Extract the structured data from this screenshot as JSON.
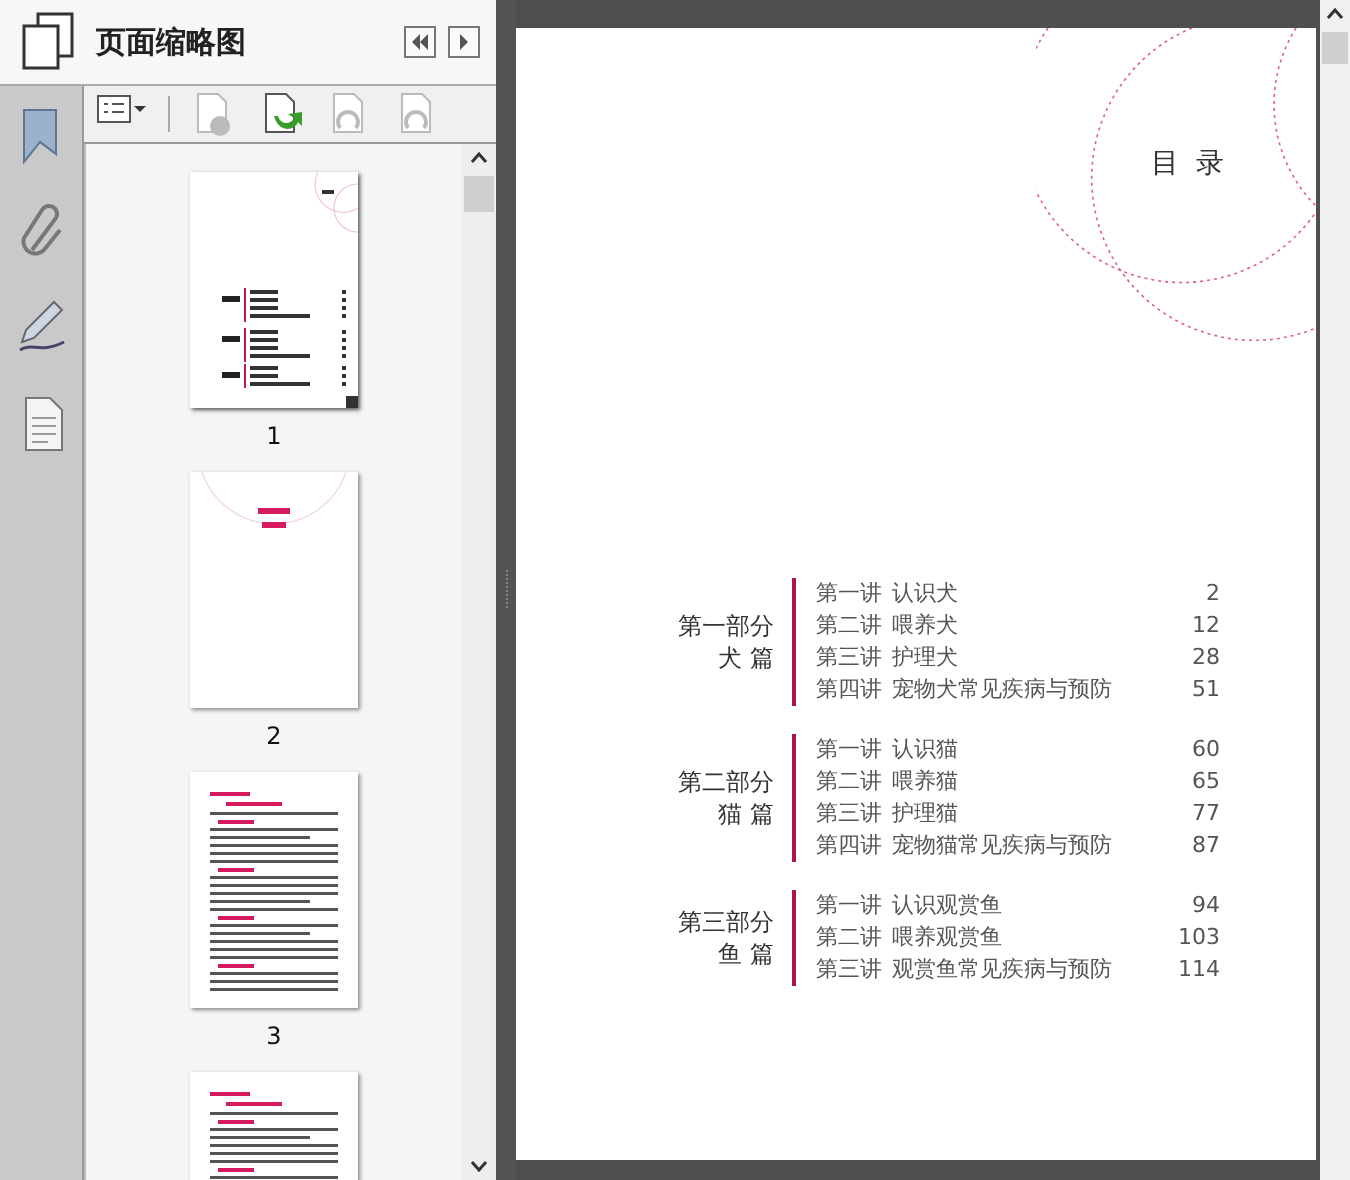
{
  "panel": {
    "title": "页面缩略图"
  },
  "rail_icons": [
    {
      "kind": "bookmark"
    },
    {
      "kind": "attachment"
    },
    {
      "kind": "signature"
    },
    {
      "kind": "page"
    }
  ],
  "toolbar_buttons": [
    {
      "kind": "options",
      "disabled": false
    },
    {
      "kind": "delete",
      "disabled": true
    },
    {
      "kind": "insert",
      "disabled": false
    },
    {
      "kind": "undo",
      "disabled": true
    },
    {
      "kind": "redo",
      "disabled": true
    }
  ],
  "thumbnails": [
    {
      "kind": "toc",
      "label": "1",
      "selected": true
    },
    {
      "kind": "cover",
      "label": "2",
      "selected": false
    },
    {
      "kind": "text",
      "label": "3",
      "selected": false
    },
    {
      "kind": "text",
      "selected": false
    }
  ],
  "document": {
    "title": "目 录",
    "sections": [
      {
        "part": "第一部分",
        "name": "犬 篇",
        "entries": [
          {
            "lecture": "第一讲",
            "title": "认识犬",
            "page": "2"
          },
          {
            "lecture": "第二讲",
            "title": "喂养犬",
            "page": "12"
          },
          {
            "lecture": "第三讲",
            "title": "护理犬",
            "page": "28"
          },
          {
            "lecture": "第四讲",
            "title": "宠物犬常见疾病与预防",
            "page": "51"
          }
        ]
      },
      {
        "part": "第二部分",
        "name": "猫 篇",
        "entries": [
          {
            "lecture": "第一讲",
            "title": "认识猫",
            "page": "60"
          },
          {
            "lecture": "第二讲",
            "title": "喂养猫",
            "page": "65"
          },
          {
            "lecture": "第三讲",
            "title": "护理猫",
            "page": "77"
          },
          {
            "lecture": "第四讲",
            "title": "宠物猫常见疾病与预防",
            "page": "87"
          }
        ]
      },
      {
        "part": "第三部分",
        "name": "鱼 篇",
        "entries": [
          {
            "lecture": "第一讲",
            "title": "认识观赏鱼",
            "page": "94"
          },
          {
            "lecture": "第二讲",
            "title": "喂养观赏鱼",
            "page": "103"
          },
          {
            "lecture": "第三讲",
            "title": "观赏鱼常见疾病与预防",
            "page": "114"
          }
        ]
      }
    ]
  }
}
